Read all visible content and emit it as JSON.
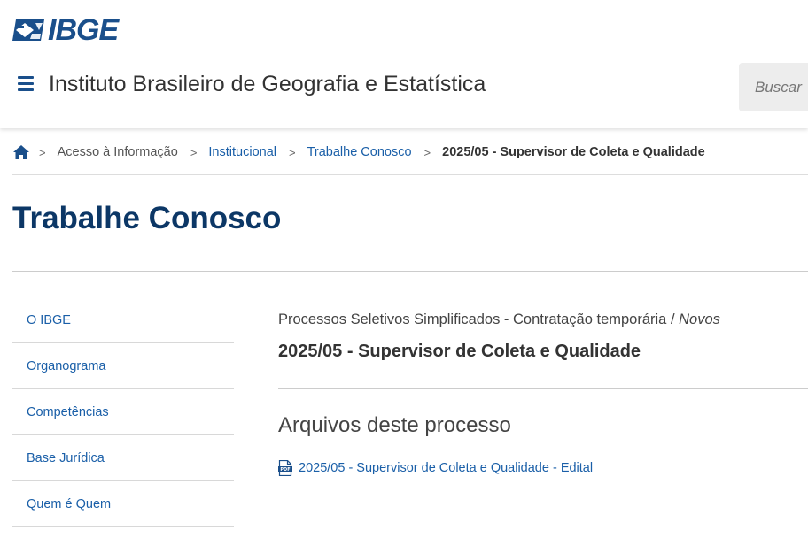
{
  "header": {
    "logo_text": "IBGE",
    "site_title": "Instituto Brasileiro de Geografia e Estatística",
    "search_placeholder": "Buscar"
  },
  "breadcrumb": {
    "items": [
      {
        "label": "Acesso à Informação"
      },
      {
        "label": "Institucional"
      },
      {
        "label": "Trabalhe Conosco"
      }
    ],
    "current": "2025/05 - Supervisor de Coleta e Qualidade",
    "separator": ">"
  },
  "page": {
    "title": "Trabalhe Conosco"
  },
  "sidebar": {
    "items": [
      {
        "label": "O IBGE"
      },
      {
        "label": "Organograma"
      },
      {
        "label": "Competências"
      },
      {
        "label": "Base Jurídica"
      },
      {
        "label": "Quem é Quem"
      }
    ]
  },
  "main": {
    "category": "Processos Seletivos Simplificados - Contratação temporária",
    "category_sep": "/",
    "category_status": "Novos",
    "process_title": "2025/05 - Supervisor de Coleta e Qualidade",
    "files_heading": "Arquivos deste processo",
    "files": [
      {
        "label": "2025/05 - Supervisor de Coleta e Qualidade - Edital"
      }
    ]
  },
  "colors": {
    "brand_blue": "#1a4f8b",
    "link_blue": "#1a5fa8",
    "title_navy": "#0c3766"
  },
  "icons": {
    "menu": "hamburger-menu-icon",
    "home": "home-icon",
    "file": "pdf-file-icon"
  }
}
